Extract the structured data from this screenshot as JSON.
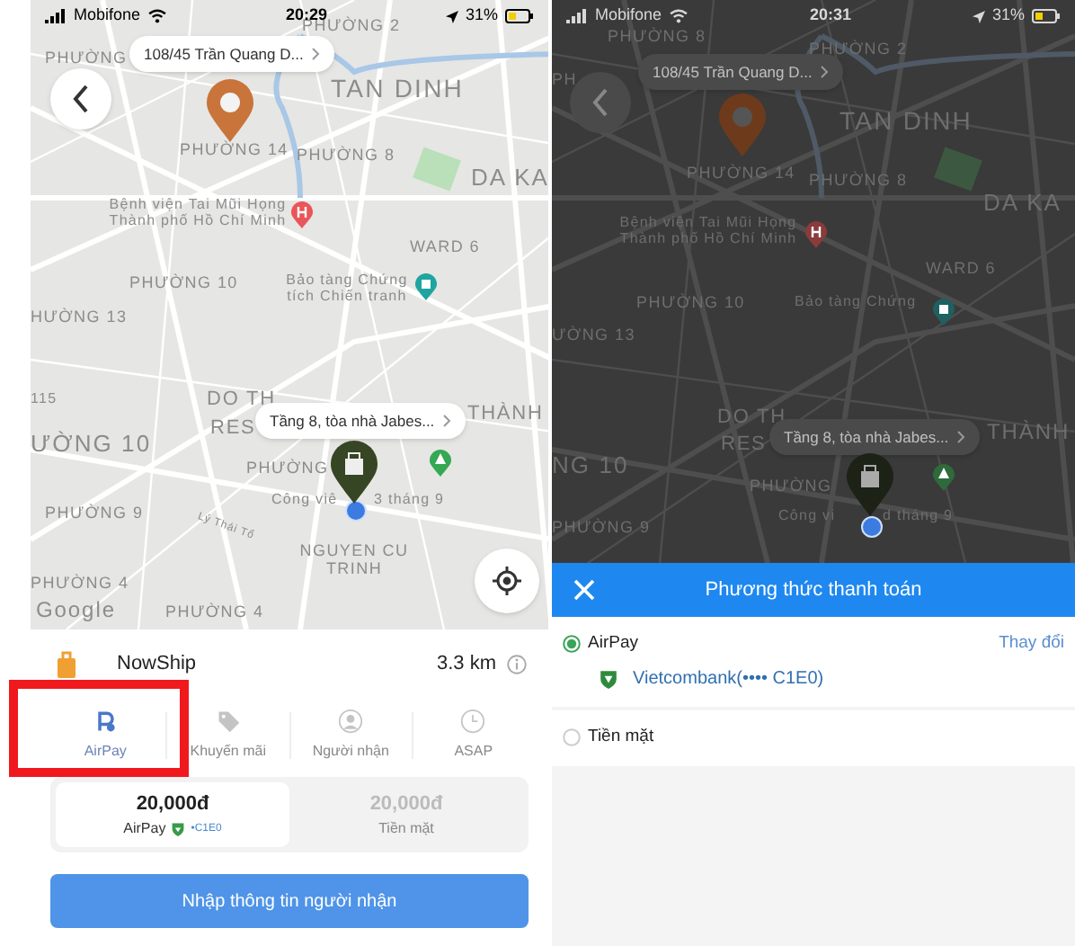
{
  "order_screen": {
    "status_bar": {
      "carrier": "Mobifone",
      "time": "20:29",
      "battery": "31%"
    },
    "map": {
      "dimmed": false,
      "pickup_callout": "108/45 Trần Quang D...",
      "dropoff_callout": "Tầng 8, tòa nhà Jabes...",
      "labels": [
        {
          "text": "PHƯỜNG 2"
        },
        {
          "text": "PHƯỜNG"
        },
        {
          "text": "TAN DINH"
        },
        {
          "text": "PHƯỜNG 14"
        },
        {
          "text": "PHƯỜNG 8"
        },
        {
          "text": "DA KA"
        },
        {
          "text": "Bệnh viện Tai Mũi Họng Thành phố Hồ Chí Minh"
        },
        {
          "text": "WARD 6"
        },
        {
          "text": "PHƯỜNG 10"
        },
        {
          "text": "Bảo tàng Chứng tích Chiến tranh"
        },
        {
          "text": "HƯỜNG 13"
        },
        {
          "text": "115"
        },
        {
          "text": "DO TH"
        },
        {
          "text": "RES"
        },
        {
          "text": "THÀNH"
        },
        {
          "text": "ƯỜNG 10"
        },
        {
          "text": "PHƯỜNG"
        },
        {
          "text": "Công viê"
        },
        {
          "text": "3 tháng 9"
        },
        {
          "text": "PHƯỜNG 9"
        },
        {
          "text": "Lý Thái Tổ"
        },
        {
          "text": "NGUYEN CU TRINH"
        },
        {
          "text": "PHƯỜNG 4"
        },
        {
          "text": "PHƯỜNG 4"
        },
        {
          "text": "Google"
        }
      ]
    },
    "service": {
      "name": "NowShip",
      "distance": "3.3 km"
    },
    "options": [
      {
        "label": "AirPay",
        "selected": true
      },
      {
        "label": "Khuyến mãi",
        "selected": false
      },
      {
        "label": "Người nhận",
        "selected": false
      },
      {
        "label": "ASAP",
        "selected": false
      }
    ],
    "payment_cards": [
      {
        "amount": "20,000đ",
        "method": "AirPay",
        "card": "•C1E0",
        "selected": true
      },
      {
        "amount": "20,000đ",
        "method": "Tiền mặt",
        "selected": false
      }
    ],
    "next_button": "Nhập thông tin người nhận",
    "annotation": {
      "kind": "highlight"
    }
  },
  "payment_screen": {
    "status_bar": {
      "carrier": "Mobifone",
      "time": "20:31",
      "battery": "31%"
    },
    "map": {
      "dimmed": true,
      "pickup_callout": "108/45 Trần Quang D...",
      "dropoff_callout": "Tầng 8, tòa nhà Jabes...",
      "labels": [
        {
          "text": "PHƯỜNG 8"
        },
        {
          "text": "PHƯỜNG 2"
        },
        {
          "text": "PH"
        },
        {
          "text": "TAN DINH"
        },
        {
          "text": "PHƯỜNG 14"
        },
        {
          "text": "PHƯỜNG 8"
        },
        {
          "text": "DA KA"
        },
        {
          "text": "Bệnh viện Tai Mũi Họng Thành phố Hồ Chí Minh"
        },
        {
          "text": "WARD 6"
        },
        {
          "text": "PHƯỜNG 10"
        },
        {
          "text": "Bảo tàng Chứng"
        },
        {
          "text": "ƯỜNG 13"
        },
        {
          "text": "DO TH"
        },
        {
          "text": "RES"
        },
        {
          "text": "THÀNH"
        },
        {
          "text": "NG 10"
        },
        {
          "text": "PHƯỜNG"
        },
        {
          "text": "Công vi"
        },
        {
          "text": "d tháng 9"
        },
        {
          "text": "PHƯỜNG 9"
        }
      ]
    },
    "sheet": {
      "title": "Phương thức thanh toán",
      "methods": [
        {
          "label": "AirPay",
          "selected": true,
          "account": "Vietcombank(•••• C1E0)",
          "action": "Thay đổi"
        },
        {
          "label": "Tiền mặt",
          "selected": false
        }
      ]
    }
  }
}
